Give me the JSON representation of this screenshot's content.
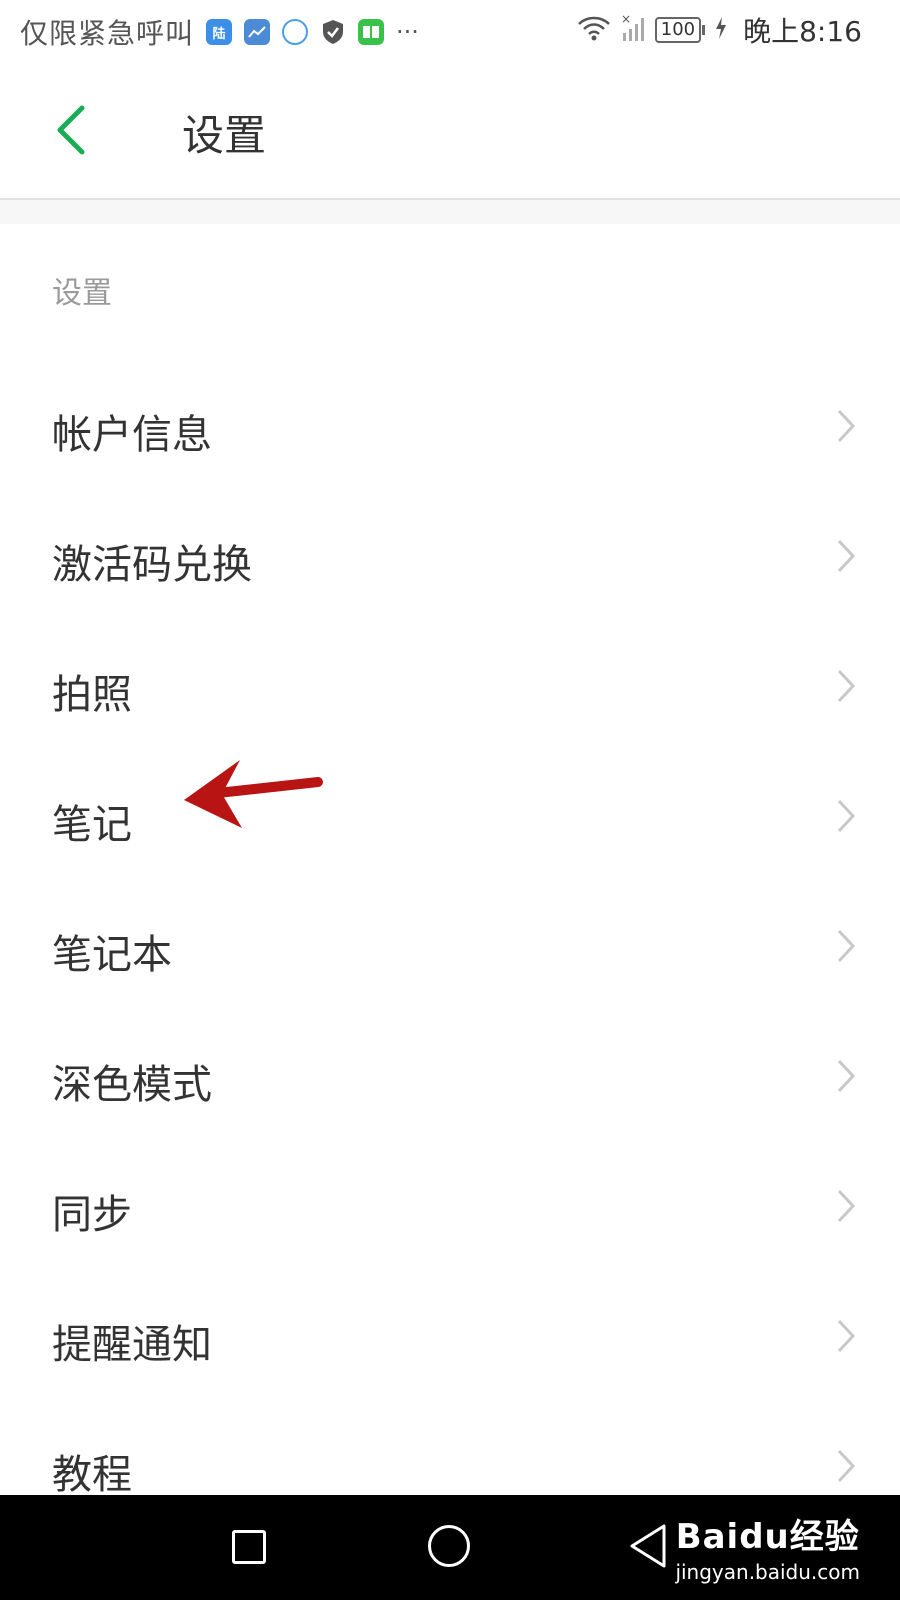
{
  "status_bar": {
    "carrier": "仅限紧急呼叫",
    "notification_icons": [
      "陆"
    ],
    "more": "···",
    "battery": "100",
    "time": "晚上8:16"
  },
  "header": {
    "title": "设置"
  },
  "section": {
    "label": "设置"
  },
  "items": [
    {
      "label": "帐户信息"
    },
    {
      "label": "激活码兑换"
    },
    {
      "label": "拍照"
    },
    {
      "label": "笔记"
    },
    {
      "label": "笔记本"
    },
    {
      "label": "深色模式"
    },
    {
      "label": "同步"
    },
    {
      "label": "提醒通知"
    },
    {
      "label": "教程"
    }
  ],
  "watermark": {
    "logo": "Baidu经验",
    "url": "jingyan.baidu.com"
  },
  "colors": {
    "accent_green": "#1aad55",
    "annotation_red": "#b81414",
    "divider": "#e2e2e2"
  }
}
